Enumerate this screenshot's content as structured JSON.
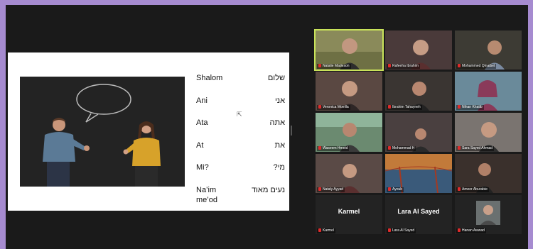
{
  "slide": {
    "vocab": [
      {
        "english": "Shalom",
        "hebrew": "שלום"
      },
      {
        "english": "Ani",
        "hebrew": "אני"
      },
      {
        "english": "Ata",
        "hebrew": "אתה"
      },
      {
        "english": "At",
        "hebrew": "את"
      },
      {
        "english": "Mi?",
        "hebrew": "מי?"
      },
      {
        "english": "Na’im me’od",
        "hebrew": "נעים מאוד"
      }
    ]
  },
  "participants": [
    {
      "name": "Natalie Madeson",
      "bg": "#8a8a5a",
      "active": true
    },
    {
      "name": "Rafeeha Ibrahim",
      "bg": "#4a3a3a"
    },
    {
      "name": "Mohammed Qinaibet",
      "bg": "#3d3b34"
    },
    {
      "name": "Veronica Moeilla",
      "bg": "#5a4842"
    },
    {
      "name": "Ibrahim Tahayneh",
      "bg": "#3a3532"
    },
    {
      "name": "Nihan Khatib",
      "bg": "#6a8a9a"
    },
    {
      "name": "Waseem Hmeid",
      "bg": "#6b8a70"
    },
    {
      "name": "Mohammad H",
      "bg": "#4a4040"
    },
    {
      "name": "Sara Sayed Ahmad",
      "bg": "#7a7470"
    },
    {
      "name": "Nataly Ayyad",
      "bg": "#5a4a46"
    },
    {
      "name": "Ayoub",
      "bg": "#c27a3a"
    },
    {
      "name": "Ameer Aburabie",
      "bg": "#3a302c"
    },
    {
      "name": "Karmel",
      "display": "Karmel",
      "bg": "#232323",
      "no_video": true
    },
    {
      "name": "Lara Al Sayed",
      "display": "Lara Al Sayed",
      "bg": "#232323",
      "no_video": true
    },
    {
      "name": "Hanan Awwad",
      "bg": "#232323",
      "photo": true
    }
  ]
}
